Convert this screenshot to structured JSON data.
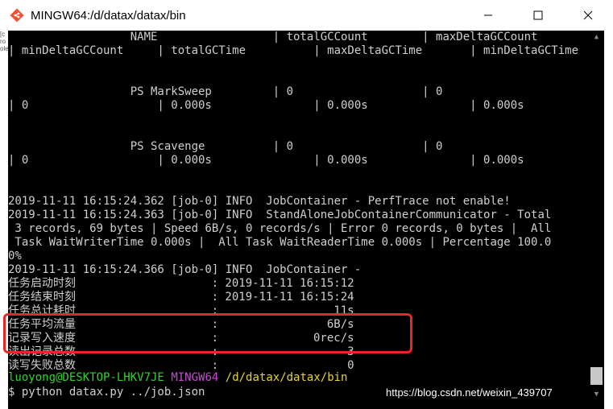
{
  "window": {
    "title": "MINGW64:/d/datax/datax/bin",
    "icon": "git-bash-icon",
    "controls": {
      "minimize": "minimize-icon",
      "maximize": "maximize-icon",
      "close": "close-icon"
    }
  },
  "left_strip": [
    "[c",
    "ro",
    "ole"
  ],
  "terminal": {
    "lines": [
      "                  NAME                 | totalGCCount        | maxDeltaGCCount",
      "| minDeltaGCCount     | totalGCTime          | maxDeltaGCTime       | minDeltaGCTime",
      "",
      "",
      "                  PS MarkSweep         | 0                   | 0",
      "| 0                   | 0.000s               | 0.000s               | 0.000s",
      "",
      "",
      "                  PS Scavenge          | 0                   | 0",
      "| 0                   | 0.000s               | 0.000s               | 0.000s",
      "",
      "",
      "2019-11-11 16:15:24.362 [job-0] INFO  JobContainer - PerfTrace not enable!",
      "2019-11-11 16:15:24.363 [job-0] INFO  StandAloneJobContainerCommunicator - Total",
      " 3 records, 69 bytes | Speed 6B/s, 0 records/s | Error 0 records, 0 bytes |  All",
      " Task WaitWriterTime 0.000s |  All Task WaitReaderTime 0.000s | Percentage 100.0",
      "0%",
      "2019-11-11 16:15:24.366 [job-0] INFO  JobContainer -",
      "任务启动时刻                    : 2019-11-11 16:15:12",
      "任务结束时刻                    : 2019-11-11 16:15:24",
      "任务总计耗时                    :                 11s",
      "任务平均流量                    :                6B/s",
      "记录写入速度                    :              0rec/s",
      "读出记录总数                    :                   3",
      "读写失败总数                    :                   0",
      "",
      "",
      ""
    ],
    "prompt": {
      "user_host": "luoyong@DESKTOP-LHKV7JE",
      "system": "MINGW64",
      "path": "/d/datax/datax/bin"
    },
    "command": "$ python datax.py ../job.json"
  },
  "watermark": "https://blog.csdn.net/weixin_439707",
  "colors": {
    "highlight": "#e8262a",
    "prompt_user": "#2fd32f",
    "prompt_system": "#c84ad6",
    "prompt_path": "#e6d432"
  }
}
